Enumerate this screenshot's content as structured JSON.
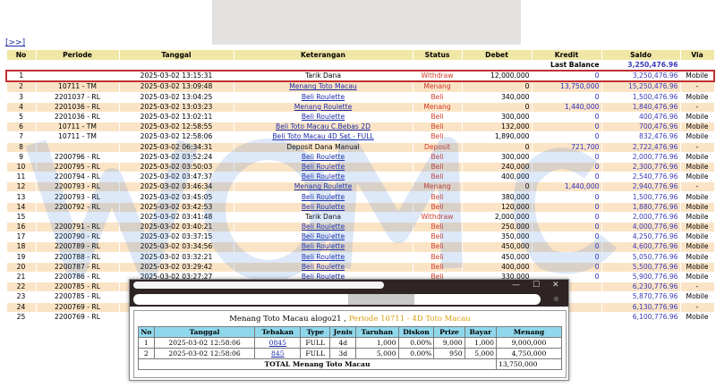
{
  "nav_link": "[>>]",
  "columns": [
    "No",
    "Periode",
    "Tanggal",
    "Keterangan",
    "Status",
    "Debet",
    "Kredit",
    "Saldo",
    "Via"
  ],
  "last_balance": {
    "label": "Last Balance",
    "value": "3,250,476.96"
  },
  "rows": [
    {
      "no": "1",
      "periode": "",
      "tanggal": "2025-03-02 13:15:31",
      "ket": "Tarik Dana",
      "link": false,
      "status": "Withdraw",
      "debet": "12,000,000",
      "kredit": "0",
      "saldo": "3,250,476.96",
      "via": "Mobile"
    },
    {
      "no": "2",
      "periode": "10711 - TM",
      "tanggal": "2025-03-02 13:09:48",
      "ket": "Menang Toto Macau",
      "link": true,
      "status": "Menang",
      "debet": "0",
      "kredit": "13,750,000",
      "saldo": "15,250,476.96",
      "via": "-"
    },
    {
      "no": "3",
      "periode": "2201037 - RL",
      "tanggal": "2025-03-02 13:04:25",
      "ket": "Beli Roulette",
      "link": true,
      "status": "Beli",
      "debet": "340,000",
      "kredit": "0",
      "saldo": "1,500,476.96",
      "via": "Mobile"
    },
    {
      "no": "4",
      "periode": "2201036 - RL",
      "tanggal": "2025-03-02 13:03:23",
      "ket": "Menang Roulette",
      "link": true,
      "status": "Menang",
      "debet": "0",
      "kredit": "1,440,000",
      "saldo": "1,840,476.96",
      "via": "-"
    },
    {
      "no": "5",
      "periode": "2201036 - RL",
      "tanggal": "2025-03-02 13:02:11",
      "ket": "Beli Roulette",
      "link": true,
      "status": "Beli",
      "debet": "300,000",
      "kredit": "0",
      "saldo": "400,476.96",
      "via": "Mobile"
    },
    {
      "no": "6",
      "periode": "10711 - TM",
      "tanggal": "2025-03-02 12:58:55",
      "ket": "Beli Toto Macau C.Bebas 2D",
      "link": true,
      "status": "Beli",
      "debet": "132,000",
      "kredit": "0",
      "saldo": "700,476.96",
      "via": "Mobile"
    },
    {
      "no": "7",
      "periode": "10711 - TM",
      "tanggal": "2025-03-02 12:58:06",
      "ket": "Beli Toto Macau 4D Set - FULL",
      "link": true,
      "status": "Beli",
      "debet": "1,890,000",
      "kredit": "0",
      "saldo": "832,476.96",
      "via": "Mobile"
    },
    {
      "no": "8",
      "periode": "",
      "tanggal": "2025-03-02 06:34:31",
      "ket": "Deposit Dana Manual",
      "link": false,
      "status": "Deposit",
      "debet": "0",
      "kredit": "721,700",
      "saldo": "2,722,476.96",
      "via": "-"
    },
    {
      "no": "9",
      "periode": "2200796 - RL",
      "tanggal": "2025-03-02 03:52:24",
      "ket": "Beli Roulette",
      "link": true,
      "status": "Beli",
      "debet": "300,000",
      "kredit": "0",
      "saldo": "2,000,776.96",
      "via": "Mobile"
    },
    {
      "no": "10",
      "periode": "2200795 - RL",
      "tanggal": "2025-03-02 03:50:03",
      "ket": "Beli Roulette",
      "link": true,
      "status": "Beli",
      "debet": "240,000",
      "kredit": "0",
      "saldo": "2,300,776.96",
      "via": "Mobile"
    },
    {
      "no": "11",
      "periode": "2200794 - RL",
      "tanggal": "2025-03-02 03:47:37",
      "ket": "Beli Roulette",
      "link": true,
      "status": "Beli",
      "debet": "400,000",
      "kredit": "0",
      "saldo": "2,540,776.96",
      "via": "Mobile"
    },
    {
      "no": "12",
      "periode": "2200793 - RL",
      "tanggal": "2025-03-02 03:46:34",
      "ket": "Menang Roulette",
      "link": true,
      "status": "Menang",
      "debet": "0",
      "kredit": "1,440,000",
      "saldo": "2,940,776.96",
      "via": "-"
    },
    {
      "no": "13",
      "periode": "2200793 - RL",
      "tanggal": "2025-03-02 03:45:05",
      "ket": "Beli Roulette",
      "link": true,
      "status": "Beli",
      "debet": "380,000",
      "kredit": "0",
      "saldo": "1,500,776.96",
      "via": "Mobile"
    },
    {
      "no": "14",
      "periode": "2200792 - RL",
      "tanggal": "2025-03-02 03:42:53",
      "ket": "Beli Roulette",
      "link": true,
      "status": "Beli",
      "debet": "120,000",
      "kredit": "0",
      "saldo": "1,880,776.96",
      "via": "Mobile"
    },
    {
      "no": "15",
      "periode": "",
      "tanggal": "2025-03-02 03:41:48",
      "ket": "Tarik Dana",
      "link": false,
      "status": "Withdraw",
      "debet": "2,000,000",
      "kredit": "0",
      "saldo": "2,000,776.96",
      "via": "Mobile"
    },
    {
      "no": "16",
      "periode": "2200791 - RL",
      "tanggal": "2025-03-02 03:40:21",
      "ket": "Beli Roulette",
      "link": true,
      "status": "Beli",
      "debet": "250,000",
      "kredit": "0",
      "saldo": "4,000,776.96",
      "via": "Mobile"
    },
    {
      "no": "17",
      "periode": "2200790 - RL",
      "tanggal": "2025-03-02 03:37:15",
      "ket": "Beli Roulette",
      "link": true,
      "status": "Beli",
      "debet": "350,000",
      "kredit": "0",
      "saldo": "4,250,776.96",
      "via": "Mobile"
    },
    {
      "no": "18",
      "periode": "2200789 - RL",
      "tanggal": "2025-03-02 03:34:56",
      "ket": "Beli Roulette",
      "link": true,
      "status": "Beli",
      "debet": "450,000",
      "kredit": "0",
      "saldo": "4,600,776.96",
      "via": "Mobile"
    },
    {
      "no": "19",
      "periode": "2200788 - RL",
      "tanggal": "2025-03-02 03:32:21",
      "ket": "Beli Roulette",
      "link": true,
      "status": "Beli",
      "debet": "450,000",
      "kredit": "0",
      "saldo": "5,050,776.96",
      "via": "Mobile"
    },
    {
      "no": "20",
      "periode": "2200787 - RL",
      "tanggal": "2025-03-02 03:29:42",
      "ket": "Beli Roulette",
      "link": true,
      "status": "Beli",
      "debet": "400,000",
      "kredit": "0",
      "saldo": "5,500,776.96",
      "via": "Mobile"
    },
    {
      "no": "21",
      "periode": "2200786 - RL",
      "tanggal": "2025-03-02 03:27:27",
      "ket": "Beli Roulette",
      "link": true,
      "status": "Beli",
      "debet": "330,000",
      "kredit": "0",
      "saldo": "5,900,776.96",
      "via": "Mobile"
    },
    {
      "no": "22",
      "periode": "2200785 - RL",
      "tanggal": "",
      "ket": "",
      "link": false,
      "status": "",
      "debet": "",
      "kredit": "",
      "saldo": "6,230,776.96",
      "via": "-"
    },
    {
      "no": "23",
      "periode": "2200785 - RL",
      "tanggal": "",
      "ket": "",
      "link": false,
      "status": "",
      "debet": "",
      "kredit": "",
      "saldo": "5,870,776.96",
      "via": "Mobile"
    },
    {
      "no": "24",
      "periode": "2200769 - RL",
      "tanggal": "",
      "ket": "",
      "link": false,
      "status": "",
      "debet": "",
      "kredit": "",
      "saldo": "6,130,776.96",
      "via": "-"
    },
    {
      "no": "25",
      "periode": "2200769 - RL",
      "tanggal": "",
      "ket": "",
      "link": false,
      "status": "",
      "debet": "",
      "kredit": "",
      "saldo": "6,100,776.96",
      "via": "Mobile"
    }
  ],
  "popup": {
    "window_buttons": [
      "—",
      "☐",
      "✕"
    ],
    "title_prefix": "Menang Toto Macau alogo21 ,",
    "title_periode": "Periode 10711 - 4D Toto Macau",
    "columns": [
      "No",
      "Tanggal",
      "Tebakan",
      "Type",
      "Jenis",
      "Taruhan",
      "Diskon",
      "Prize",
      "Bayar",
      "Menang"
    ],
    "rows": [
      {
        "no": "1",
        "tanggal": "2025-03-02 12:58:06",
        "tebakan": "0845",
        "type": "FULL",
        "jenis": "4d",
        "taruhan": "1,000",
        "diskon": "0.00%",
        "prize": "9,000",
        "bayar": "1,000",
        "menang": "9,000,000"
      },
      {
        "no": "2",
        "tanggal": "2025-03-02 12:58:06",
        "tebakan": "845",
        "type": "FULL",
        "jenis": "3d",
        "taruhan": "5,000",
        "diskon": "0.00%",
        "prize": "950",
        "bayar": "5,000",
        "menang": "4,750,000"
      }
    ],
    "total_label": "TOTAL  Menang Toto Macau",
    "total_value": "13,750,000"
  },
  "colors": {
    "header": "#f0e7a6",
    "row_alt": "#fbe4c6",
    "link": "#1a2aa8",
    "status_red": "#d23b2b",
    "popup_header": "#8fd8ec",
    "highlight": "#c03030"
  }
}
